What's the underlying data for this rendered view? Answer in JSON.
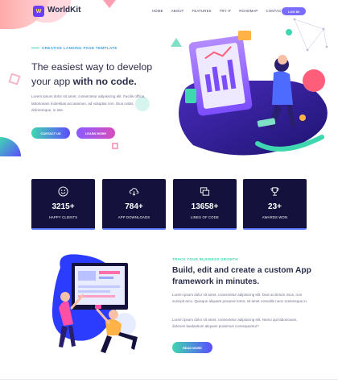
{
  "header": {
    "logo_mark": "W",
    "logo_text": "WorldKit",
    "nav": [
      "HOME",
      "ABOUT",
      "FEATURES",
      "TRY IT",
      "ROADMAP",
      "CONTACT"
    ],
    "login_label": "LOG IN"
  },
  "hero": {
    "tagline": "CREATIVE LANDING PAGE TEMPLATE",
    "title_line1": "The easiest way to develop",
    "title_line2_prefix": "your app ",
    "title_line2_bold": "with no code.",
    "description": "Lorem ipsum dolor sit amet, consectetur adipisicing elit. Facilis officia, laboriosam molestias accusamus, ad voluptas non. Eius nobis, doloremque, in iste.",
    "btn_contact": "CONTACT US",
    "btn_learn": "LEARN MORE"
  },
  "stats": [
    {
      "icon": "smile-icon",
      "value": "3215+",
      "label": "HAPPY CLIENTS"
    },
    {
      "icon": "cloud-download-icon",
      "value": "784+",
      "label": "APP DOWNLOADS"
    },
    {
      "icon": "code-windows-icon",
      "value": "13658+",
      "label": "LINES OF CODE"
    },
    {
      "icon": "trophy-icon",
      "value": "23+",
      "label": "AWARDS WON"
    }
  ],
  "about": {
    "tag": "TRACK YOUR BUSINESS GROWTH",
    "title": "Build, edit and create a custom App framework in minutes.",
    "p1": "Lorem ipsum dolor sit amet, consectetur adipisicing elit. Duis at dictum risus, non suscipit arcu. Quisque aliquam posuere tortor, sit amet convallis nunc scelerisque in.",
    "p2": "Lorem ipsum dolor sit amet, consectetur adipisicing elit. Nemo qui laboriosam, dolorum laudantium aliquam possimus consequuntur?",
    "btn_readmore": "READ MORE"
  },
  "colors": {
    "accent_purple": "#6a3dff",
    "accent_teal": "#3fd7b0",
    "stat_bg": "#14123d",
    "text_dark": "#2b2e4a"
  }
}
